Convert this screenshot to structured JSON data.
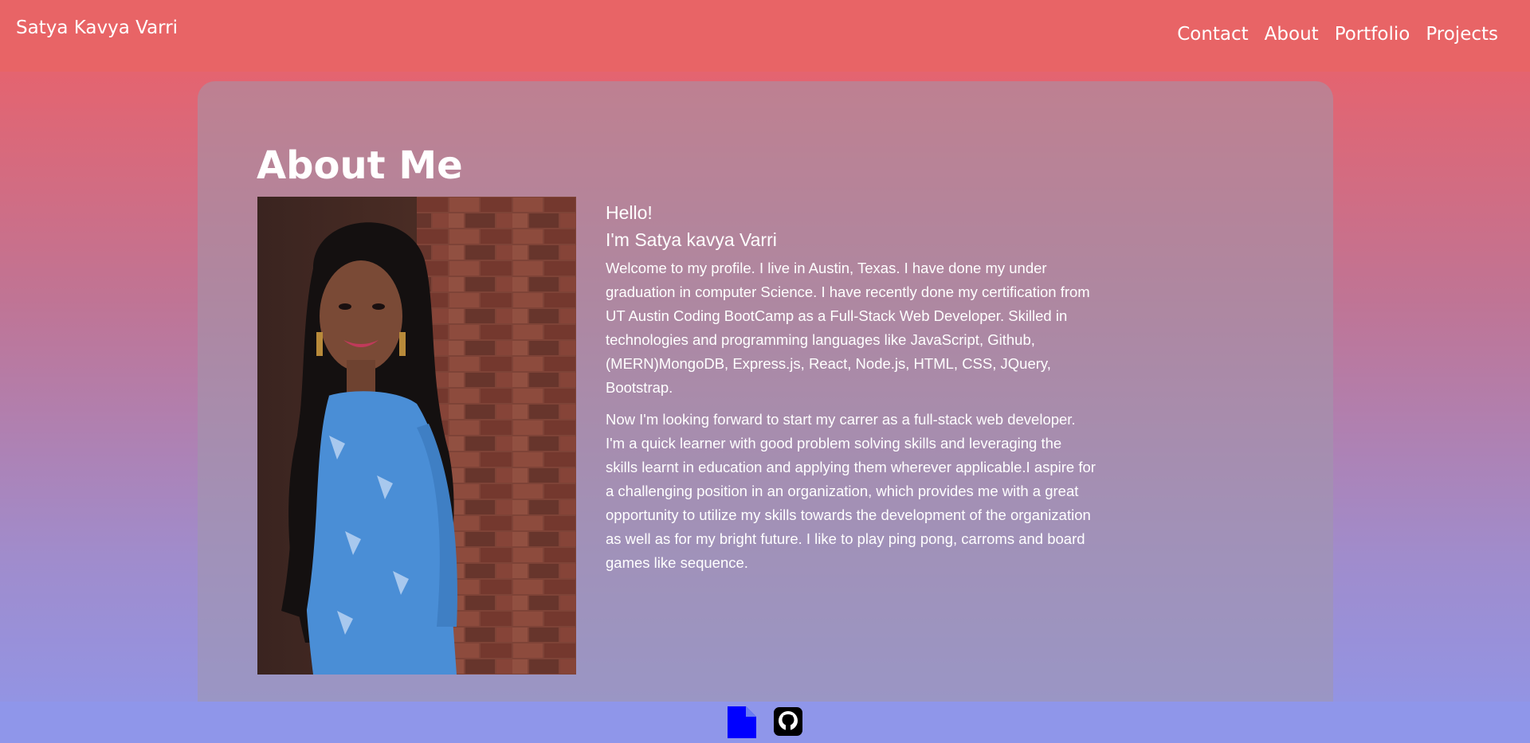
{
  "navbar": {
    "brand": "Satya Kavya Varri",
    "links": [
      "Contact",
      "About",
      "Portfolio",
      "Projects"
    ]
  },
  "about": {
    "title": "About Me",
    "greeting": "Hello!",
    "name_line": "I'm Satya kavya Varri",
    "paragraphs": [
      "Welcome to my profile. I live in Austin, Texas. I have done my under graduation in computer Science. I have recently done my certification from UT Austin Coding BootCamp as a Full-Stack Web Developer. Skilled in technologies and programming languages like JavaScript, Github, (MERN)MongoDB, Express.js, React, Node.js, HTML, CSS, JQuery, Bootstrap.",
      "Now I'm looking forward to start my carrer as a full-stack web developer. I'm a quick learner with good problem solving skills and leveraging the skills learnt in education and applying them wherever applicable.I aspire for a challenging position in an organization, which provides me with a great opportunity to utilize my skills towards the development of the organization as well as for my bright future. I like to play ping pong, carroms and board games like sequence."
    ]
  },
  "footer": {
    "icons": [
      "file-icon",
      "github-icon"
    ]
  },
  "colors": {
    "navbar": "#e86466",
    "footer": "#8f96ea",
    "resume_icon": "#0000ff",
    "github_icon": "#000000"
  }
}
